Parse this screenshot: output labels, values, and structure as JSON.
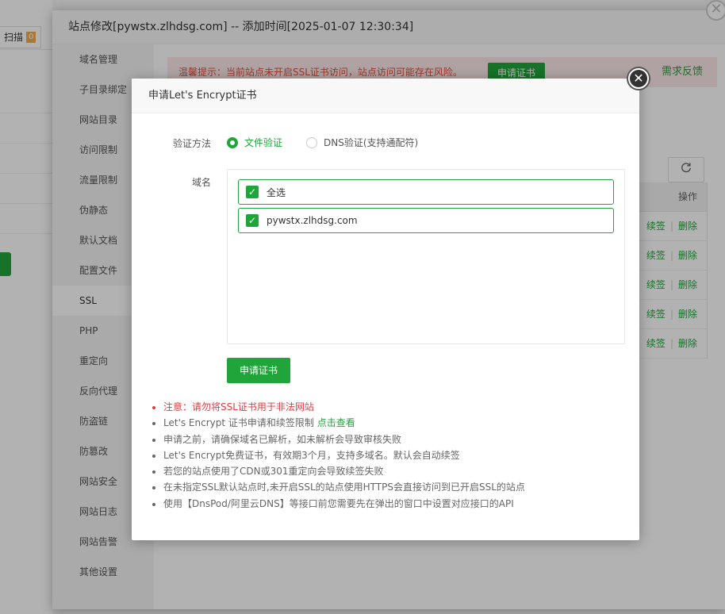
{
  "background": {
    "scan_button": "扫描",
    "scan_badge": "0"
  },
  "site_window": {
    "title": "站点修改[pywstx.zlhdsg.com] -- 添加时间[2025-01-07 12:30:34]",
    "close_glyph": "✕",
    "nav": [
      "域名管理",
      "子目录绑定",
      "网站目录",
      "访问限制",
      "流量限制",
      "伪静态",
      "默认文档",
      "配置文件",
      "SSL",
      "PHP",
      "重定向",
      "反向代理",
      "防盗链",
      "防篡改",
      "网站安全",
      "网站日志",
      "网站告警",
      "其他设置"
    ],
    "active_nav": "SSL",
    "warning_text": "温馨提示：当前站点未开启SSL证书访问，站点访问可能存在风险。",
    "warning_button": "申请证书",
    "feedback_link": "需求反馈",
    "table_header_ops": "操作",
    "row_actions": [
      {
        "renew": "续签",
        "delete": "删除"
      },
      {
        "renew": "续签",
        "delete": "删除"
      },
      {
        "renew": "续签",
        "delete": "删除"
      },
      {
        "renew": "续签",
        "delete": "删除"
      },
      {
        "renew": "续签",
        "delete": "删除"
      }
    ]
  },
  "dialog": {
    "title": "申请Let's Encrypt证书",
    "verify_label": "验证方法",
    "verify_options": [
      {
        "label": "文件验证",
        "selected": true
      },
      {
        "label": "DNS验证(支持通配符)",
        "selected": false
      }
    ],
    "domain_label": "域名",
    "domains": [
      {
        "label": "全选",
        "checked": true
      },
      {
        "label": "pywstx.zlhdsg.com",
        "checked": true
      }
    ],
    "apply_button": "申请证书",
    "notes": {
      "n1": "注意：请勿将SSL证书用于非法网站",
      "n2_prefix": "Let's Encrypt 证书申请和续签限制 ",
      "n2_link": "点击查看",
      "n3": "申请之前，请确保域名已解析，如未解析会导致审核失败",
      "n4": "Let's Encrypt免费证书，有效期3个月，支持多域名。默认会自动续签",
      "n5": "若您的站点使用了CDN或301重定向会导致续签失败",
      "n6": "在未指定SSL默认站点时,未开启SSL的站点使用HTTPS会直接访问到已开启SSL的站点",
      "n7": "使用【DnsPod/阿里云DNS】等接口前您需要先在弹出的窗口中设置对应接口的API"
    }
  },
  "colors": {
    "accent": "#20a53a",
    "warning": "#e74c3c",
    "overlay": "rgba(0,0,0,0.3)"
  },
  "icons": {
    "refresh": "refresh-icon",
    "close": "close-icon",
    "check": "check-icon"
  }
}
